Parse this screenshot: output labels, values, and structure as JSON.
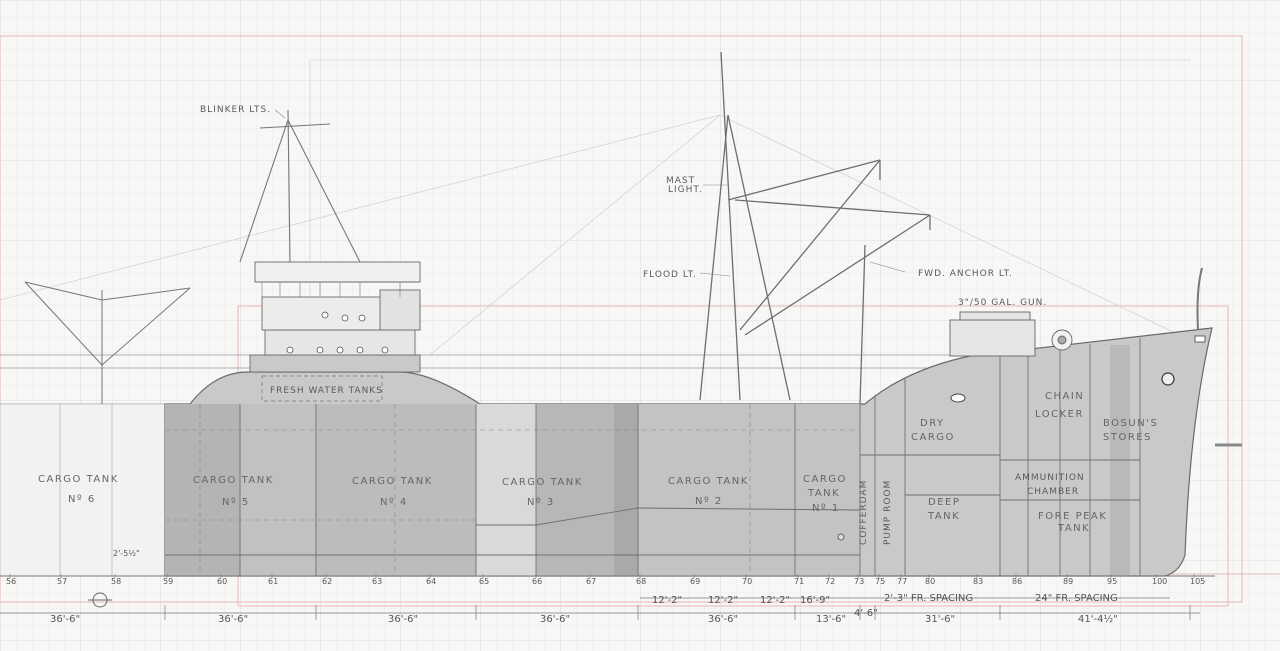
{
  "labels": {
    "blinker_lts": "BLINKER LTS.",
    "mast_light_1": "MAST",
    "mast_light_2": "LIGHT.",
    "flood_lt": "FLOOD LT.",
    "fwd_anchor_lt": "FWD. ANCHOR LT.",
    "gun": "3\"/50 GAL. GUN.",
    "fresh_water": "FRESH WATER TANKS",
    "cargo_tank": "CARGO TANK",
    "no6": "Nº 6",
    "no5": "Nº 5",
    "no4": "Nº 4",
    "no3": "Nº 3",
    "no2": "Nº 2",
    "no1": "Nº 1",
    "dry_cargo_1": "DRY",
    "dry_cargo_2": "CARGO",
    "deep_tank_1": "DEEP",
    "deep_tank_2": "TANK",
    "chain_locker_1": "CHAIN",
    "chain_locker_2": "LOCKER",
    "bosuns_1": "BOSUN'S",
    "bosuns_2": "STORES",
    "ammo_1": "AMMUNITION",
    "ammo_2": "CHAMBER",
    "fore_peak_1": "FORE PEAK",
    "fore_peak_2": "TANK",
    "cofferdam": "COFFERDAM",
    "pump_room": "PUMP ROOM"
  },
  "frames": [
    "56",
    "57",
    "58",
    "59",
    "60",
    "61",
    "62",
    "63",
    "64",
    "65",
    "66",
    "67",
    "68",
    "69",
    "70",
    "71",
    "72",
    "73",
    "75",
    "77",
    "80",
    "83",
    "86",
    "89",
    "95",
    "100",
    "105"
  ],
  "dimensions": {
    "d1": "36'-6\"",
    "d2": "36'-6\"",
    "d3": "36'-6\"",
    "d4": "36'-6\"",
    "d5": "36'-6\"",
    "d6": "12'-2\"",
    "d7": "12'-2\"",
    "d8": "12'-2\"",
    "d9": "16'-9\"",
    "d10": "13'-6\"",
    "d11": "4'-6\"",
    "d12": "31'-6\"",
    "d13": "41'-4½\"",
    "fr_spacing_a": "2'-3\" FR. SPACING",
    "fr_spacing_b": "24\" FR. SPACING",
    "small_dim": "2'-5½\""
  }
}
